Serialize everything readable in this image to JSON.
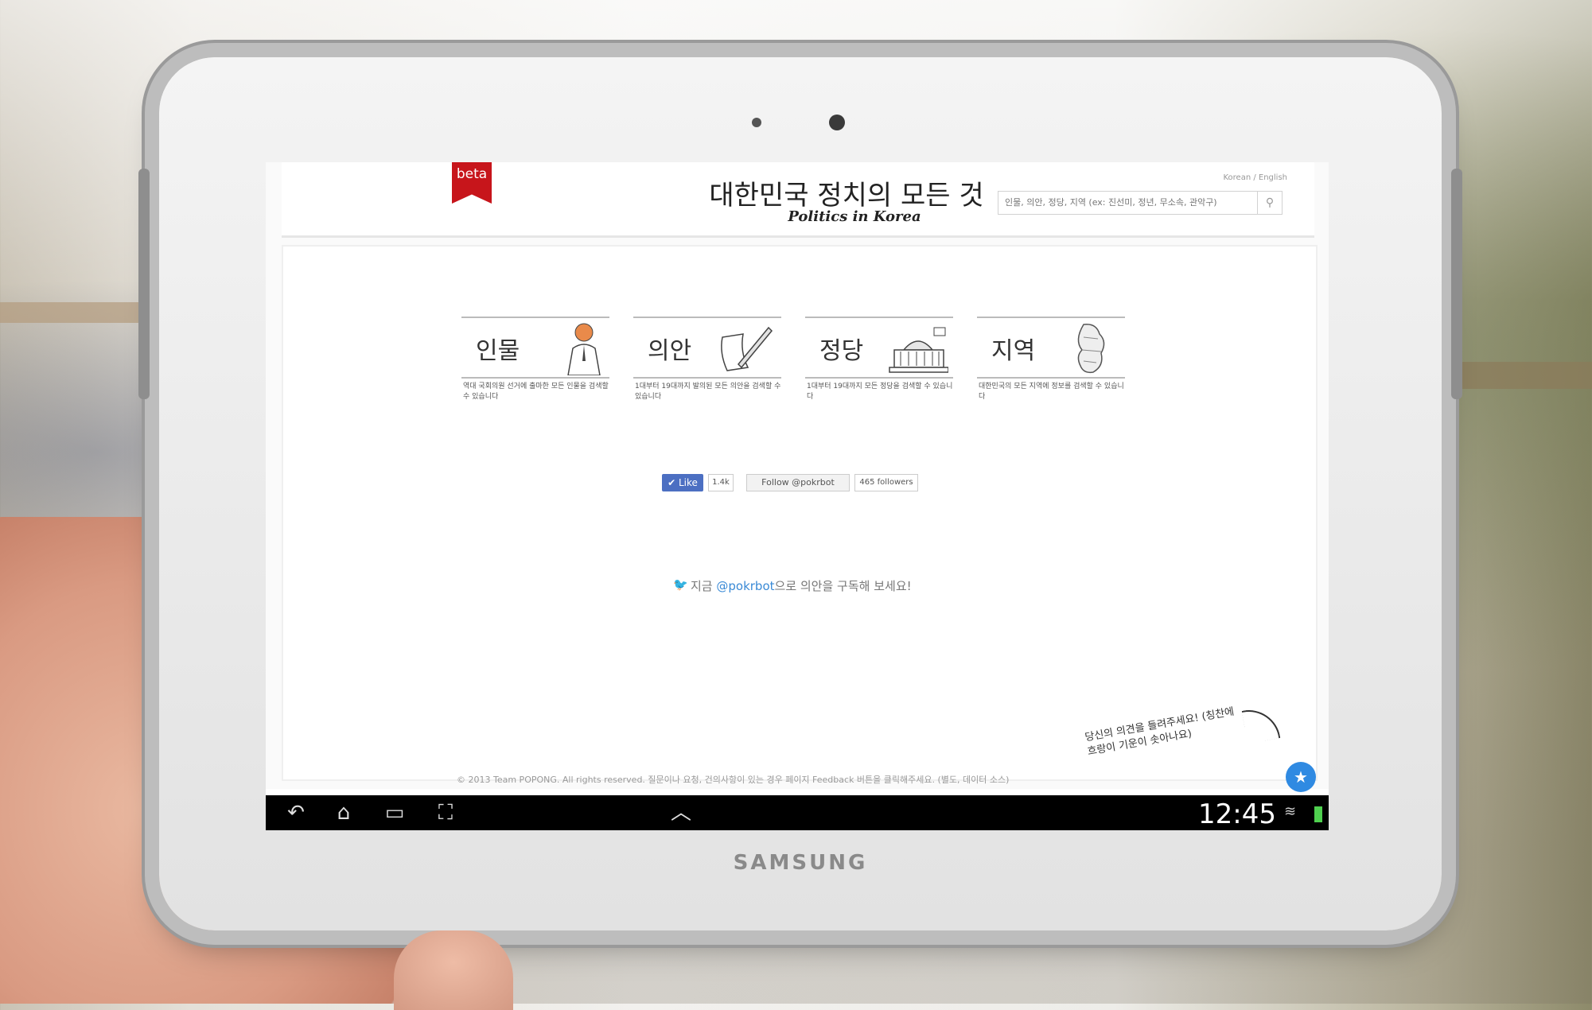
{
  "device": {
    "brand": "SAMSUNG"
  },
  "site": {
    "badge": "beta",
    "title": "대한민국 정치의 모든 것",
    "subtitle": "Politics in Korea",
    "language_switch": "Korean / English",
    "search": {
      "placeholder": "인물, 의안, 정당, 지역 (ex: 진선미, 정년, 무소속, 관악구)"
    }
  },
  "categories": [
    {
      "label": "인물",
      "icon": "person-icon",
      "desc": "역대 국회의원 선거에 출마한 모든 인물을 검색할 수 있습니다"
    },
    {
      "label": "의안",
      "icon": "document-pen-icon",
      "desc": "1대부터 19대까지 발의된 모든 의안을 검색할 수 있습니다"
    },
    {
      "label": "정당",
      "icon": "assembly-building-icon",
      "desc": "1대부터 19대까지 모든 정당을 검색할 수 있습니다"
    },
    {
      "label": "지역",
      "icon": "korea-map-icon",
      "desc": "대한민국의 모든 지역에 정보를 검색할 수 있습니다"
    }
  ],
  "social": {
    "like_label": "✔ Like",
    "like_count": "1.4k",
    "follow_label": "Follow @pokrbot",
    "followers": "465 followers"
  },
  "subscribe": {
    "prefix": "지금 ",
    "handle": "@pokrbot",
    "suffix": "으로 의안을 구독해 보세요!"
  },
  "feedback": {
    "note": "당신의 의견을 들려주세요! (칭찬에 흐랑이 기운이 솟아나요)",
    "button_icon": "star-icon"
  },
  "footer": {
    "text": "© 2013 Team POPONG. All rights reserved. 질문이나 요청, 건의사항이 있는 경우 페이지 Feedback 버튼을 클릭해주세요. (별도, 데이터 소스)"
  },
  "statusbar": {
    "time": "12:45",
    "nav_icons": [
      "back-icon",
      "home-icon",
      "recent-apps-icon",
      "screenshot-icon",
      "up-arrow-icon"
    ]
  }
}
